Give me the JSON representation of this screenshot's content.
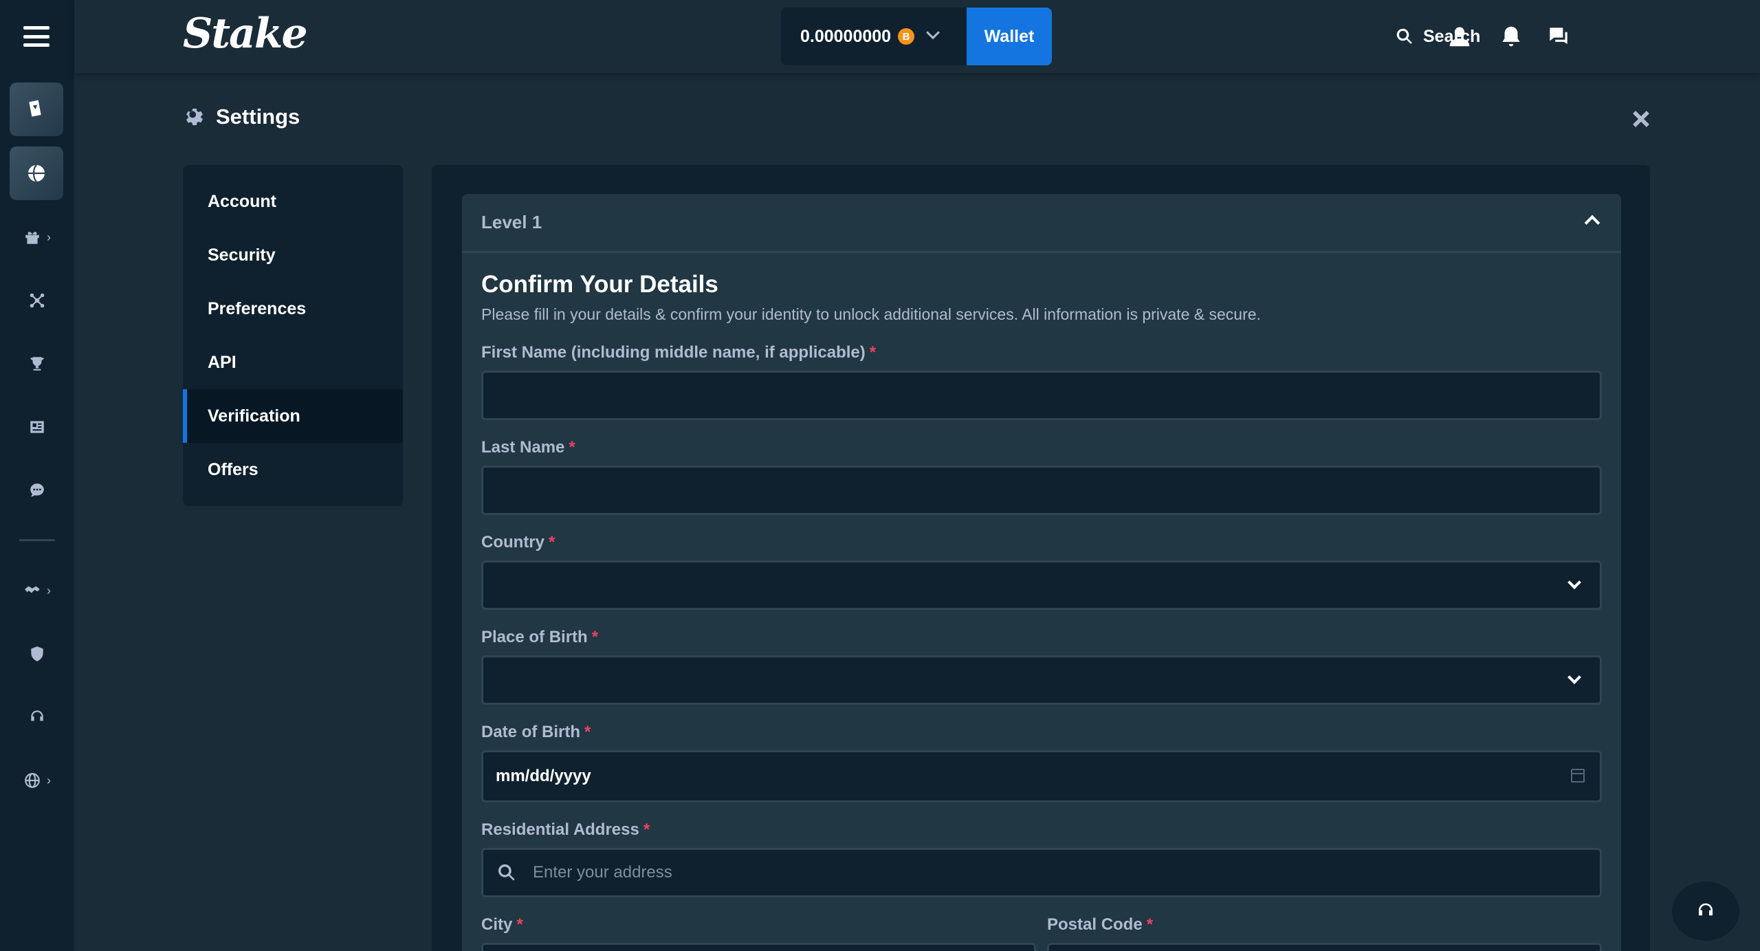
{
  "header": {
    "logo": "Stake",
    "balance": "0.00000000",
    "coin_symbol": "B",
    "wallet_label": "Wallet",
    "search_label": "Search"
  },
  "settings": {
    "title": "Settings",
    "nav": [
      {
        "label": "Account"
      },
      {
        "label": "Security"
      },
      {
        "label": "Preferences"
      },
      {
        "label": "API"
      },
      {
        "label": "Verification"
      },
      {
        "label": "Offers"
      }
    ],
    "active_nav": "Verification"
  },
  "verification": {
    "level_title": "Level 1",
    "heading": "Confirm Your Details",
    "description": "Please fill in your details & confirm your identity to unlock additional services. All information is private & secure.",
    "required_marker": "*",
    "fields": {
      "first_name": {
        "label": "First Name (including middle name, if applicable)",
        "value": ""
      },
      "last_name": {
        "label": "Last Name",
        "value": ""
      },
      "country": {
        "label": "Country",
        "value": ""
      },
      "place_of_birth": {
        "label": "Place of Birth",
        "value": ""
      },
      "date_of_birth": {
        "label": "Date of Birth",
        "value": "mm/dd/yyyy"
      },
      "address": {
        "label": "Residential Address",
        "placeholder": "Enter your address"
      },
      "city": {
        "label": "City",
        "value": ""
      },
      "postal_code": {
        "label": "Postal Code",
        "value": ""
      }
    }
  },
  "colors": {
    "background": "#1a2c38",
    "panel": "#0f212e",
    "card": "#213743",
    "accent": "#1475e1",
    "required": "#ed4163",
    "muted_text": "#b1bad3"
  }
}
